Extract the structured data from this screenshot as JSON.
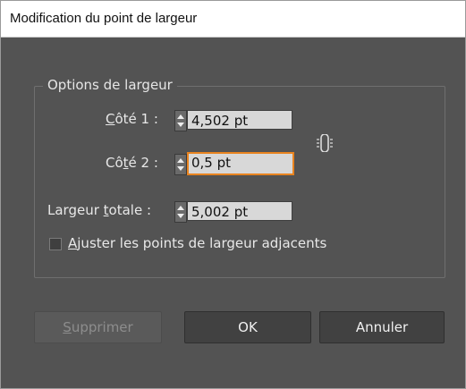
{
  "window": {
    "title": "Modification du point de largeur"
  },
  "group": {
    "label": "Options de largeur"
  },
  "side1": {
    "label_a": "C",
    "label_u": "ô",
    "label_b": "té 1 :",
    "value": "4,502 pt"
  },
  "side2": {
    "label_a": "Cô",
    "label_u": "t",
    "label_b": "é 2 :",
    "value": "0,5 pt"
  },
  "total": {
    "label_a": "Largeur ",
    "label_u": "t",
    "label_b": "otale :",
    "value": "5,002 pt"
  },
  "link_icon": "link-icon",
  "adjust": {
    "label_u": "A",
    "label_b": "juster les points de largeur adjacents",
    "checked": false
  },
  "buttons": {
    "delete_u": "S",
    "delete_b": "upprimer",
    "ok": "OK",
    "cancel": "Annuler"
  },
  "colors": {
    "background": "#535353",
    "focus": "#e8831f",
    "field": "#d8d8d8"
  }
}
